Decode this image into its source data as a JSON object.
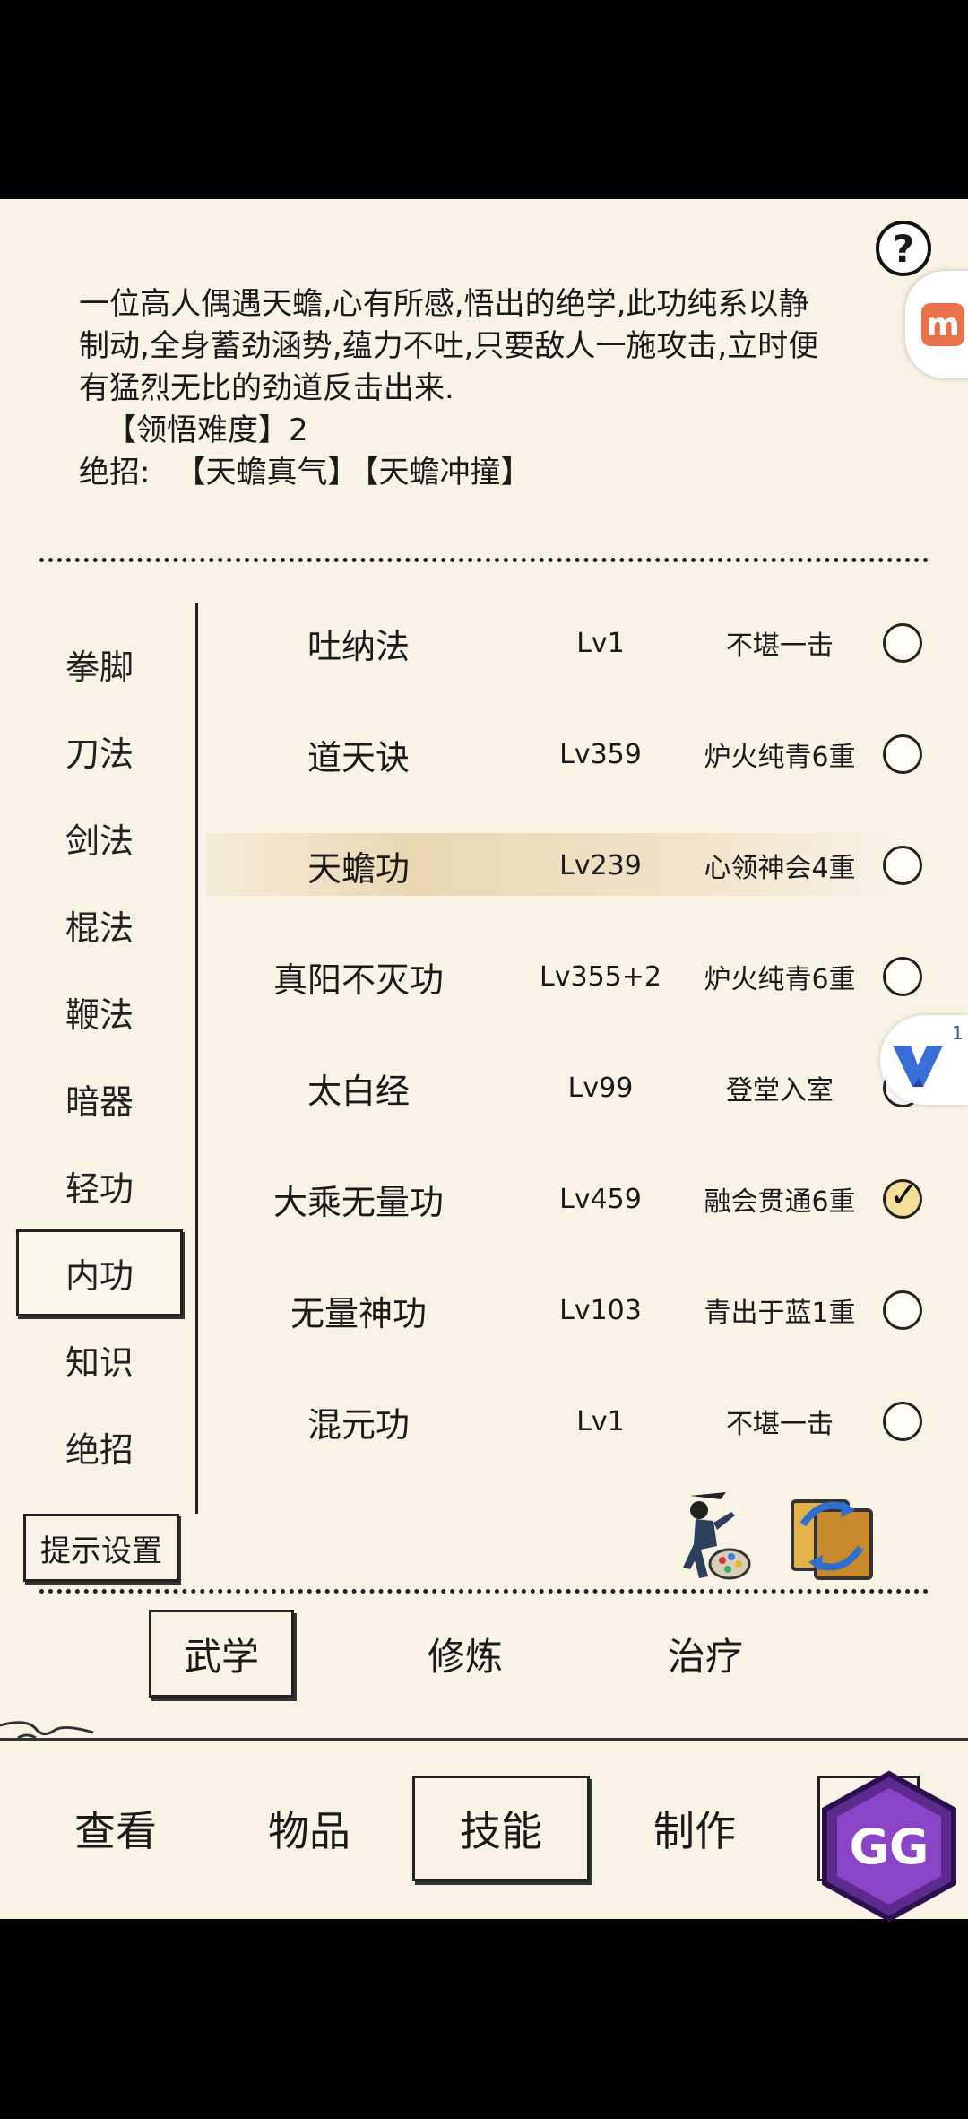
{
  "description": {
    "lines": [
      "一位高人偶遇天蟾,心有所感,悟出的绝学,此功纯系以静",
      "制动,全身蓄劲涵势,蕴力不吐,只要敌人一施攻击,立时便",
      "有猛烈无比的劲道反击出来."
    ],
    "difficulty": "【领悟难度】2",
    "ultimates_label": "绝招:",
    "ultimates": [
      "【天蟾真气】",
      "【天蟾冲撞】"
    ]
  },
  "sidebar": {
    "items": [
      "拳脚",
      "刀法",
      "剑法",
      "棍法",
      "鞭法",
      "暗器",
      "轻功",
      "内功",
      "知识",
      "绝招"
    ],
    "active": "内功",
    "hint_button": "提示设置"
  },
  "skills": [
    {
      "name": "吐纳法",
      "level": "Lv1",
      "rank": "不堪一击",
      "equipped": false
    },
    {
      "name": "道天诀",
      "level": "Lv359",
      "rank": "炉火纯青6重",
      "equipped": false
    },
    {
      "name": "天蟾功",
      "level": "Lv239",
      "rank": "心领神会4重",
      "equipped": false,
      "selected": true
    },
    {
      "name": "真阳不灭功",
      "level": "Lv355+2",
      "rank": "炉火纯青6重",
      "equipped": false
    },
    {
      "name": "太白经",
      "level": "Lv99",
      "rank": "登堂入室",
      "equipped": false
    },
    {
      "name": "大乘无量功",
      "level": "Lv459",
      "rank": "融会贯通6重",
      "equipped": true
    },
    {
      "name": "无量神功",
      "level": "Lv103",
      "rank": "青出于蓝1重",
      "equipped": false
    },
    {
      "name": "混元功",
      "level": "Lv1",
      "rank": "不堪一击",
      "equipped": false
    }
  ],
  "subtabs": [
    "武学",
    "修炼",
    "治疗"
  ],
  "subtab_active": "武学",
  "bottom_nav": [
    "查看",
    "物品",
    "技能",
    "制作"
  ],
  "bottom_active": "技能",
  "help_symbol": "?",
  "overlays": {
    "v_badge_count": "1",
    "gg_label": "GG"
  },
  "colors": {
    "paper": "#f8f3e4",
    "highlight": "#e7d3aa",
    "ink": "#1a1a1a"
  }
}
